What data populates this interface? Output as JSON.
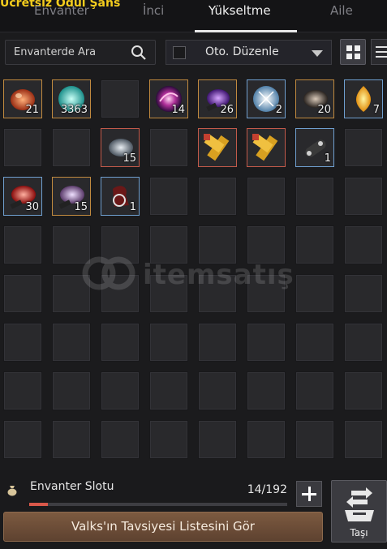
{
  "overlay": {
    "text": "Ücretsiz Ödül Şans"
  },
  "tabs": [
    {
      "label": "Envanter",
      "active": false
    },
    {
      "label": "İnci",
      "active": false
    },
    {
      "label": "Yükseltme",
      "active": true
    },
    {
      "label": "Aile",
      "active": false
    }
  ],
  "search": {
    "label": "Envanterde Ara",
    "icon": "search-icon"
  },
  "auto_sort": {
    "label": "Oto. Düzenle",
    "checked": false
  },
  "view_buttons": {
    "grid_active": true
  },
  "items": [
    {
      "row": 0,
      "col": 0,
      "name": "red-stone-icon",
      "qty": "21",
      "border": "orange"
    },
    {
      "row": 0,
      "col": 1,
      "name": "teal-crystal-icon",
      "qty": "3363",
      "border": "orange"
    },
    {
      "row": 0,
      "col": 3,
      "name": "galaxy-orb-icon",
      "qty": "14",
      "border": "orange"
    },
    {
      "row": 0,
      "col": 4,
      "name": "purple-stone-icon",
      "qty": "26",
      "border": "orange"
    },
    {
      "row": 0,
      "col": 5,
      "name": "shattered-crystal-icon",
      "qty": "2",
      "border": "blue"
    },
    {
      "row": 0,
      "col": 6,
      "name": "dark-stone-icon",
      "qty": "20",
      "border": "orange"
    },
    {
      "row": 0,
      "col": 7,
      "name": "flame-gem-icon",
      "qty": "7",
      "border": "blue"
    },
    {
      "row": 1,
      "col": 2,
      "name": "grey-stone-icon",
      "qty": "15",
      "border": "red"
    },
    {
      "row": 1,
      "col": 4,
      "name": "golden-hammer-icon",
      "qty": "",
      "border": "red"
    },
    {
      "row": 1,
      "col": 5,
      "name": "golden-hammer-icon",
      "qty": "",
      "border": "red"
    },
    {
      "row": 1,
      "col": 6,
      "name": "scroll-icon",
      "qty": "1",
      "border": "blue"
    },
    {
      "row": 2,
      "col": 0,
      "name": "blood-stone-icon",
      "qty": "30",
      "border": "blue"
    },
    {
      "row": 2,
      "col": 1,
      "name": "violet-stone-icon",
      "qty": "15",
      "border": "orange"
    },
    {
      "row": 2,
      "col": 2,
      "name": "dark-pouch-icon",
      "qty": "1",
      "border": "blue"
    }
  ],
  "watermark": {
    "text": "itemsatış"
  },
  "slots": {
    "label": "Envanter Slotu",
    "count": "14/192",
    "used_fraction": 0.073
  },
  "advice_button": {
    "label": "Valks'ın Tavsiyesi Listesini Gör"
  },
  "move_button": {
    "label": "Taşı"
  },
  "colors": {
    "orange": "#c18a3f",
    "blue": "#6f9fcf",
    "red": "#c25a4a",
    "accent": "#d9584a"
  }
}
